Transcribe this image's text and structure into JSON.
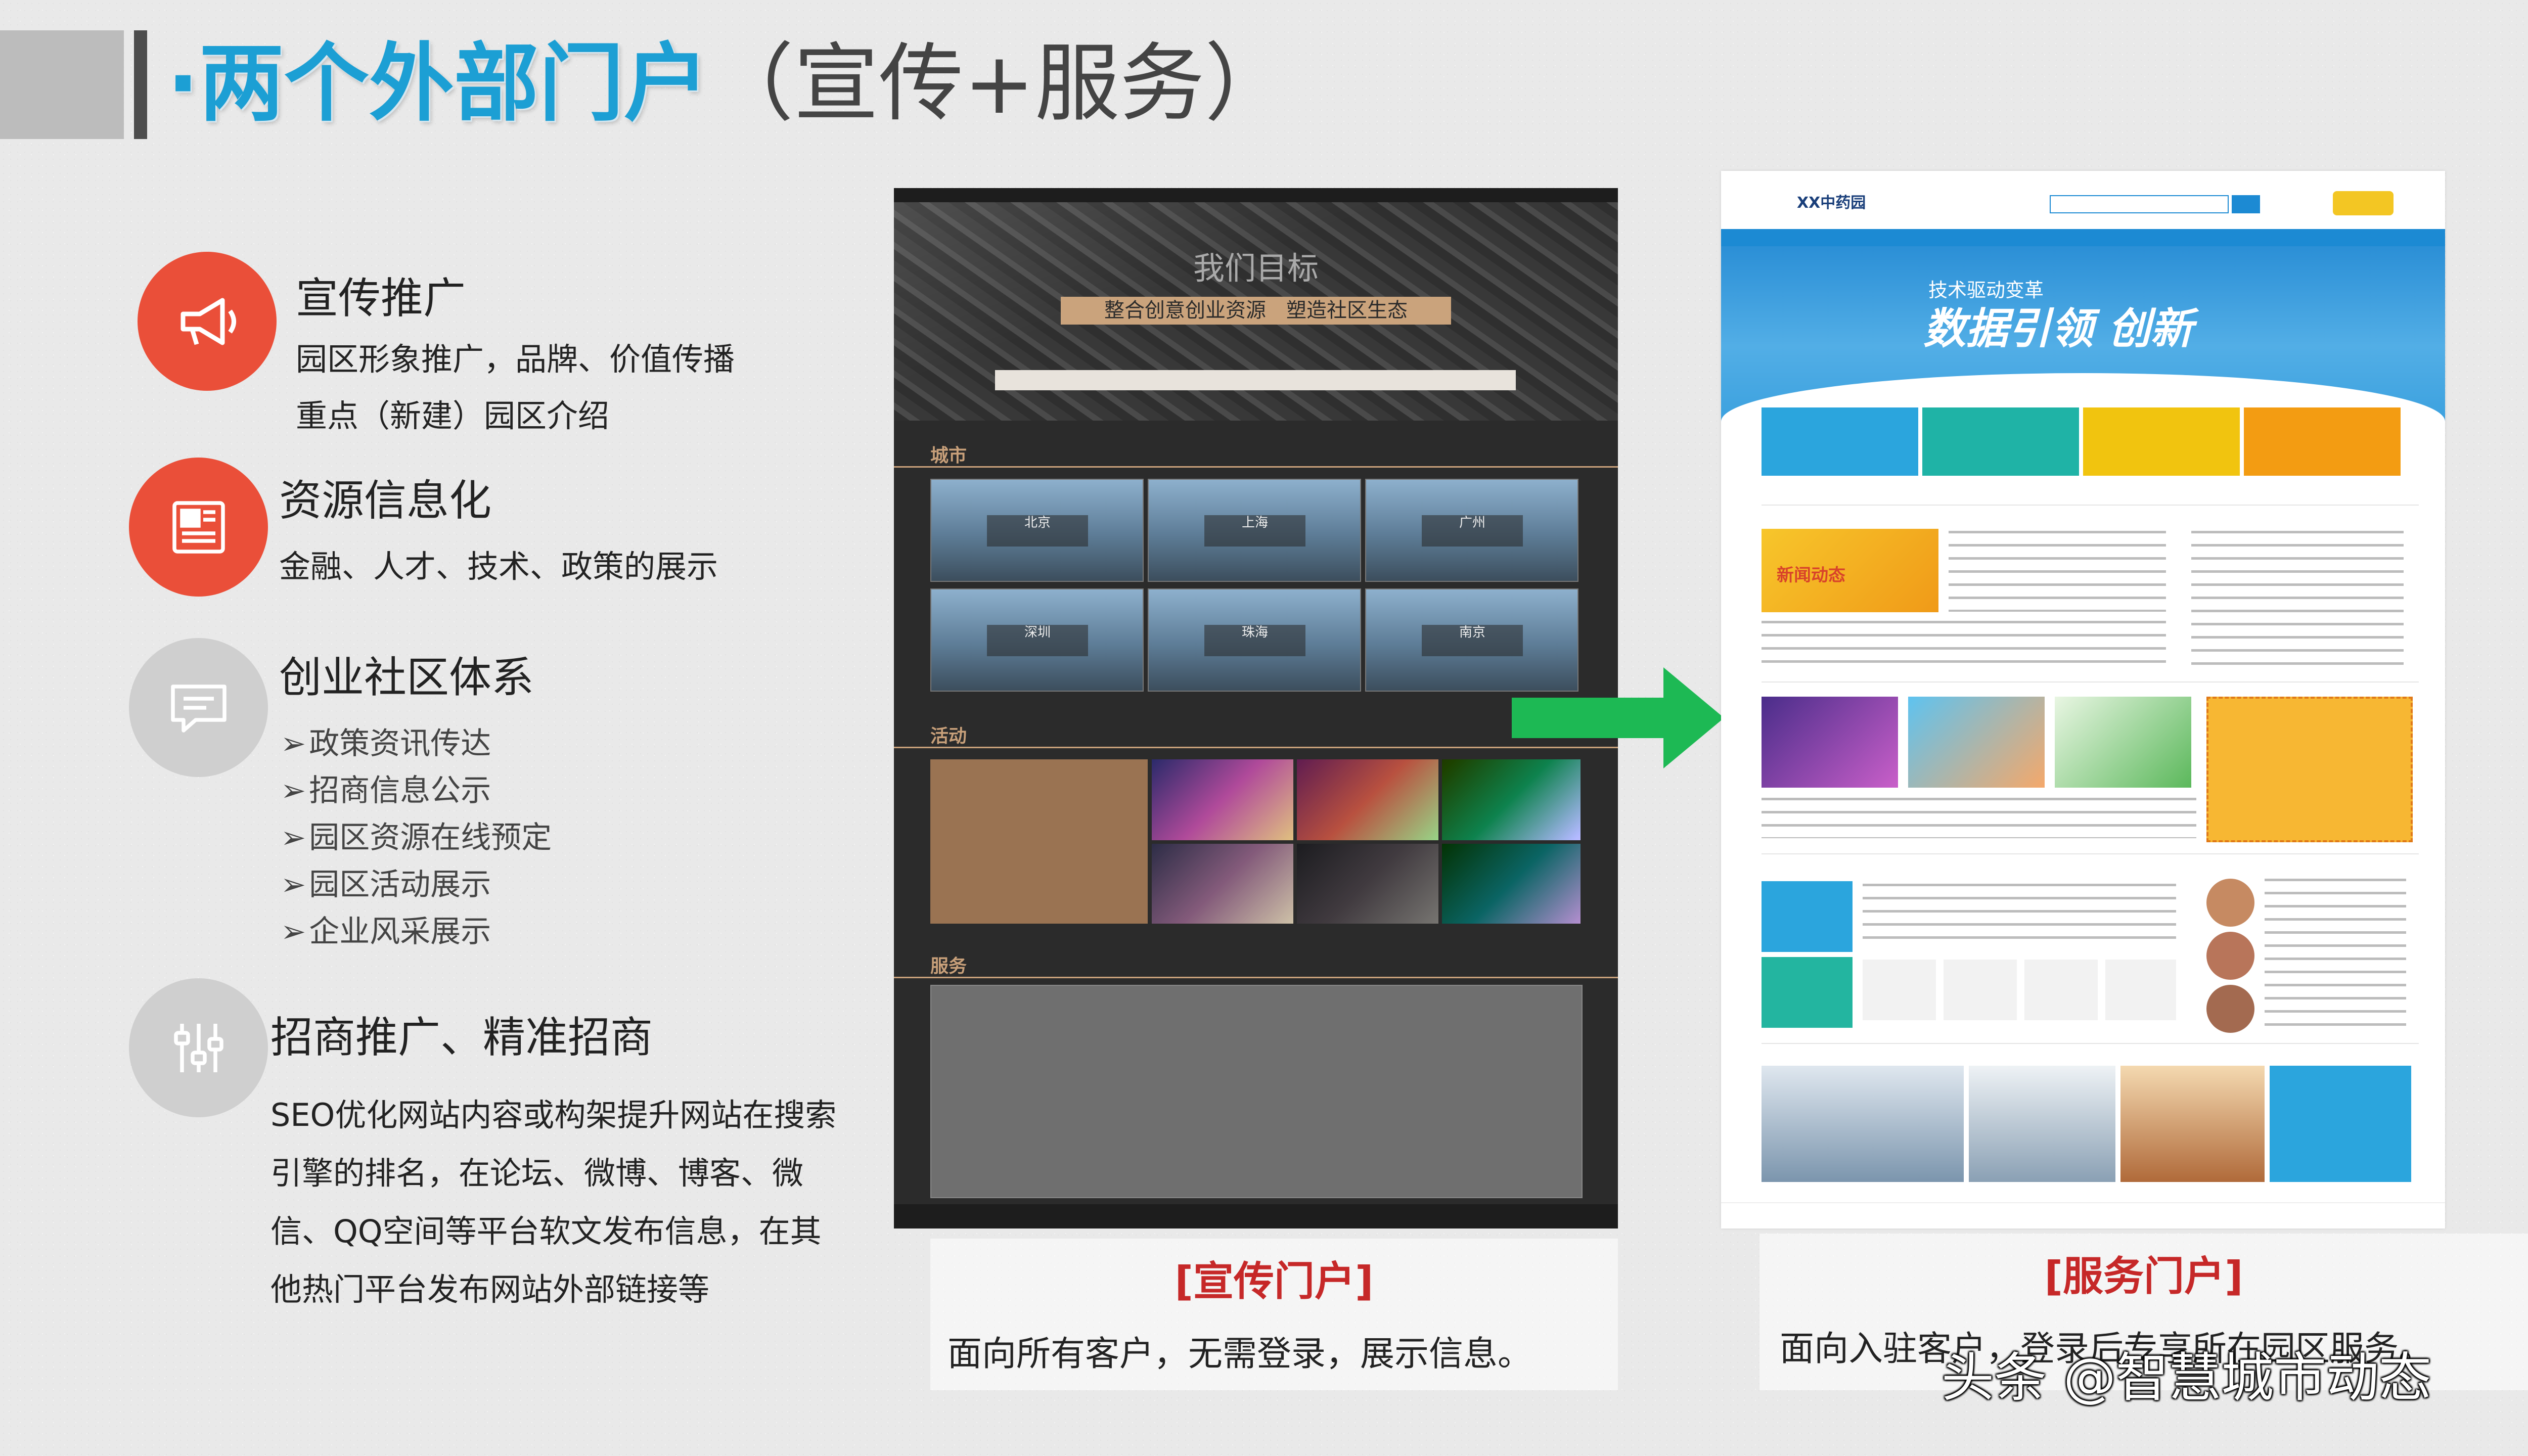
{
  "header": {
    "title_main": "·两个外部门户",
    "title_paren": "（宣传+服务）"
  },
  "features": [
    {
      "title": "宣传推广",
      "lines": [
        "园区形象推广，品牌、价值传播",
        "重点（新建）园区介绍"
      ]
    },
    {
      "title": "资源信息化",
      "lines": [
        "金融、人才、技术、政策的展示"
      ]
    },
    {
      "title": "创业社区体系",
      "bullets": [
        "政策资讯传达",
        "招商信息公示",
        "园区资源在线预定",
        "园区活动展示",
        "企业风采展示"
      ]
    },
    {
      "title": "招商推广、精准招商",
      "paragraph": "SEO优化网站内容或构架提升网站在搜索引擎的排名，在论坛、微博、博客、微信、QQ空间等平台软文发布信息，在其他热门平台发布网站外部链接等"
    }
  ],
  "promo_portal": {
    "hero_title": "我们目标",
    "hero_sub": "整合创意创业资源　塑造社区生态",
    "section_city": "城市",
    "section_activity": "活动",
    "section_service": "服务",
    "cities": [
      "北京",
      "上海",
      "广州",
      "深圳",
      "珠海",
      "南京"
    ]
  },
  "service_portal": {
    "logo": "XX中药园",
    "banner_line1": "技术驱动变革",
    "banner_line2": "数据引领 创新",
    "news_img_label": "新闻动态"
  },
  "captions": {
    "promo_title": "[宣传门户]",
    "promo_desc": "面向所有客户，无需登录，展示信息。",
    "service_title": "[服务门户]",
    "service_desc": "面向入驻客户，登录后专享所在园区服务。"
  },
  "watermark": "头条 @智慧城市动态",
  "colors": {
    "accent_blue": "#1c9fd4",
    "icon_red": "#ea4f39",
    "icon_gray": "#cfcfcf",
    "caption_red": "#c62828",
    "arrow_green": "#1db954"
  },
  "icons": [
    "megaphone-icon",
    "newspaper-icon",
    "chat-icon",
    "sliders-icon",
    "arrow-right-icon"
  ]
}
